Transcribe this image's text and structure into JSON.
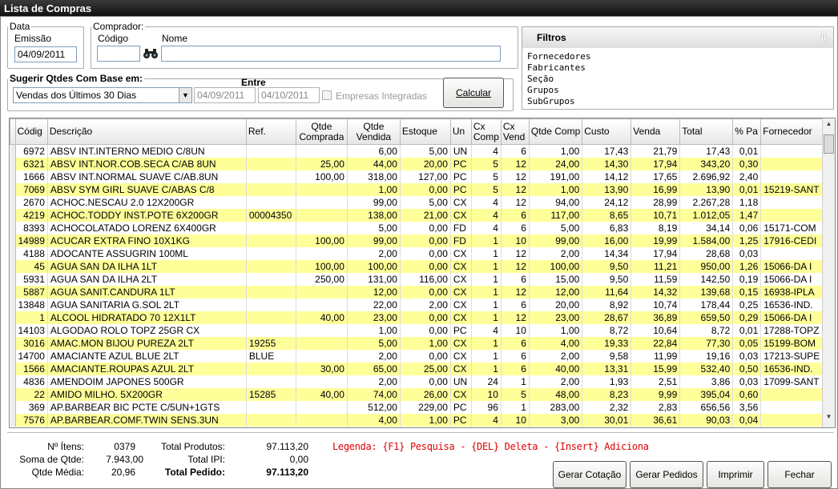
{
  "window": {
    "title": "Lista de Compras"
  },
  "data_group": {
    "legend": "Data",
    "emissao_label": "Emissão",
    "emissao_value": "04/09/2011"
  },
  "comprador": {
    "legend": "Comprador:",
    "codigo_label": "Código",
    "nome_label": "Nome",
    "codigo_value": "",
    "nome_value": ""
  },
  "sugerir": {
    "legend": "Sugerir Qtdes Com Base em:",
    "entre_label": "Entre",
    "base_select": "Vendas dos Últimos 30 Dias",
    "date_from": "04/09/2011",
    "date_to": "04/10/2011",
    "empresas_label": "Empresas Integradas",
    "calcular_label": "Calcular"
  },
  "filtros": {
    "title": "Filtros",
    "items": [
      "Fornecedores",
      "Fabricantes",
      "Seção",
      "Grupos",
      "SubGrupos"
    ]
  },
  "grid": {
    "columns": [
      "Códig",
      "Descrição",
      "Ref.",
      "Qtde Comprada",
      "Qtde Vendida",
      "Estoque",
      "Un",
      "Cx Comp",
      "Cx Vend",
      "Qtde Comp",
      "Custo",
      "Venda",
      "Total",
      "% Pa",
      "Fornecedor"
    ],
    "rows": [
      [
        "6972",
        "ABSV INT.INTERNO MEDIO C/8UN",
        "",
        "",
        "6,00",
        "5,00",
        "UN",
        "4",
        "6",
        "1,00",
        "17,43",
        "21,79",
        "17,43",
        "0,01",
        ""
      ],
      [
        "6321",
        "ABSV INT.NOR.COB.SECA C/AB 8UN",
        "",
        "25,00",
        "44,00",
        "20,00",
        "PC",
        "5",
        "12",
        "24,00",
        "14,30",
        "17,94",
        "343,20",
        "0,30",
        ""
      ],
      [
        "1666",
        "ABSV INT.NORMAL SUAVE C/AB.8UN",
        "",
        "100,00",
        "318,00",
        "127,00",
        "PC",
        "5",
        "12",
        "191,00",
        "14,12",
        "17,65",
        "2.696,92",
        "2,40",
        ""
      ],
      [
        "7069",
        "ABSV SYM GIRL SUAVE C/ABAS C/8",
        "",
        "",
        "1,00",
        "0,00",
        "PC",
        "5",
        "12",
        "1,00",
        "13,90",
        "16,99",
        "13,90",
        "0,01",
        "15219-SANT"
      ],
      [
        "2670",
        "ACHOC.NESCAU 2.0 12X200GR",
        "",
        "",
        "99,00",
        "5,00",
        "CX",
        "4",
        "12",
        "94,00",
        "24,12",
        "28,99",
        "2.267,28",
        "1,18",
        ""
      ],
      [
        "4219",
        "ACHOC.TODDY INST.POTE 6X200GR",
        "00004350",
        "",
        "138,00",
        "21,00",
        "CX",
        "4",
        "6",
        "117,00",
        "8,65",
        "10,71",
        "1.012,05",
        "1,47",
        ""
      ],
      [
        "8393",
        "ACHOCOLATADO LORENZ 6X400GR",
        "",
        "",
        "5,00",
        "0,00",
        "FD",
        "4",
        "6",
        "5,00",
        "6,83",
        "8,19",
        "34,14",
        "0,06",
        "15171-COM"
      ],
      [
        "14989",
        "ACUCAR EXTRA FINO 10X1KG",
        "",
        "100,00",
        "99,00",
        "0,00",
        "FD",
        "1",
        "10",
        "99,00",
        "16,00",
        "19,99",
        "1.584,00",
        "1,25",
        "17916-CEDI"
      ],
      [
        "4188",
        "ADOCANTE ASSUGRIN 100ML",
        "",
        "",
        "2,00",
        "0,00",
        "CX",
        "1",
        "12",
        "2,00",
        "14,34",
        "17,94",
        "28,68",
        "0,03",
        ""
      ],
      [
        "45",
        "AGUA SAN DA ILHA 1LT",
        "",
        "100,00",
        "100,00",
        "0,00",
        "CX",
        "1",
        "12",
        "100,00",
        "9,50",
        "11,21",
        "950,00",
        "1,26",
        "15066-DA I"
      ],
      [
        "5931",
        "AGUA SAN DA ILHA 2LT",
        "",
        "250,00",
        "131,00",
        "116,00",
        "CX",
        "1",
        "6",
        "15,00",
        "9,50",
        "11,59",
        "142,50",
        "0,19",
        "15066-DA I"
      ],
      [
        "5887",
        "AGUA SANIT.CANDURA 1LT",
        "",
        "",
        "12,00",
        "0,00",
        "CX",
        "1",
        "12",
        "12,00",
        "11,64",
        "14,32",
        "139,68",
        "0,15",
        "16938-IPLA"
      ],
      [
        "13848",
        "AGUA SANITARIA G.SOL 2LT",
        "",
        "",
        "22,00",
        "2,00",
        "CX",
        "1",
        "6",
        "20,00",
        "8,92",
        "10,74",
        "178,44",
        "0,25",
        "16536-IND."
      ],
      [
        "1",
        "ALCOOL HIDRATADO 70 12X1LT",
        "",
        "40,00",
        "23,00",
        "0,00",
        "CX",
        "1",
        "12",
        "23,00",
        "28,67",
        "36,89",
        "659,50",
        "0,29",
        "15066-DA I"
      ],
      [
        "14103",
        "ALGODAO ROLO TOPZ 25GR CX",
        "",
        "",
        "1,00",
        "0,00",
        "PC",
        "4",
        "10",
        "1,00",
        "8,72",
        "10,64",
        "8,72",
        "0,01",
        "17288-TOPZ"
      ],
      [
        "3016",
        "AMAC.MON BIJOU PUREZA 2LT",
        "19255",
        "",
        "5,00",
        "1,00",
        "CX",
        "1",
        "6",
        "4,00",
        "19,33",
        "22,84",
        "77,30",
        "0,05",
        "15199-BOM"
      ],
      [
        "14700",
        "AMACIANTE AZUL BLUE 2LT",
        "BLUE",
        "",
        "2,00",
        "0,00",
        "CX",
        "1",
        "6",
        "2,00",
        "9,58",
        "11,99",
        "19,16",
        "0,03",
        "17213-SUPE"
      ],
      [
        "1566",
        "AMACIANTE.ROUPAS AZUL     2LT",
        "",
        "30,00",
        "65,00",
        "25,00",
        "CX",
        "1",
        "6",
        "40,00",
        "13,31",
        "15,99",
        "532,40",
        "0,50",
        "16536-IND."
      ],
      [
        "4836",
        "AMENDOIM JAPONES 500GR",
        "",
        "",
        "2,00",
        "0,00",
        "UN",
        "24",
        "1",
        "2,00",
        "1,93",
        "2,51",
        "3,86",
        "0,03",
        "17099-SANT"
      ],
      [
        "22",
        "AMIDO MILHO. 5X200GR",
        "15285",
        "40,00",
        "74,00",
        "26,00",
        "CX",
        "10",
        "5",
        "48,00",
        "8,23",
        "9,99",
        "395,04",
        "0,60",
        ""
      ],
      [
        "369",
        "AP.BARBEAR BIC PCTE C/5UN+1GTS",
        "",
        "",
        "512,00",
        "229,00",
        "PC",
        "96",
        "1",
        "283,00",
        "2,32",
        "2,83",
        "656,56",
        "3,56",
        ""
      ],
      [
        "7576",
        "AP.BARBEAR.COMF.TWIN SENS.3UN",
        "",
        "",
        "4,00",
        "1,00",
        "PC",
        "4",
        "10",
        "3,00",
        "30,01",
        "36,61",
        "90,03",
        "0,04",
        ""
      ]
    ]
  },
  "footer": {
    "itens_label": "Nº Ítens:",
    "itens_value": "0379",
    "soma_label": "Soma de Qtde:",
    "soma_value": "7.943,00",
    "media_label": "Qtde Média:",
    "media_value": "20,96",
    "total_produtos_label": "Total Produtos:",
    "total_produtos_value": "97.113,20",
    "total_ipi_label": "Total IPI:",
    "total_ipi_value": "0,00",
    "total_pedido_label": "Total Pedido:",
    "total_pedido_value": "97.113,20",
    "legenda": "Legenda: {F1} Pesquisa  -  {DEL} Deleta  -  {Insert} Adiciona"
  },
  "buttons": {
    "gerar_cotacao": "Gerar Cotação",
    "gerar_pedidos": "Gerar Pedidos",
    "imprimir": "Imprimir",
    "fechar": "Fechar"
  }
}
